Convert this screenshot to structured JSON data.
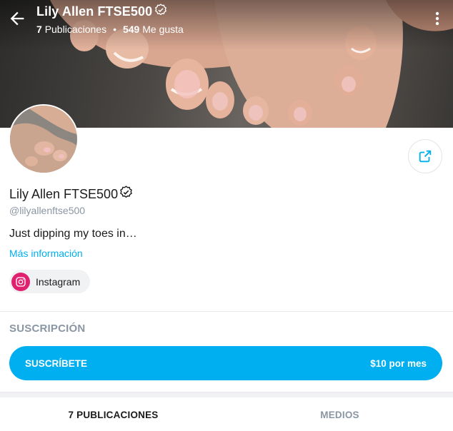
{
  "header": {
    "title": "Lily Allen FTSE500",
    "posts_count": "7",
    "posts_label": "Publicaciones",
    "separator": "•",
    "likes_count": "549",
    "likes_label": "Me gusta"
  },
  "profile": {
    "name": "Lily Allen FTSE500",
    "handle": "@lilyallenftse500",
    "bio": "Just dipping my toes in…",
    "more_info": "Más información",
    "social": [
      {
        "label": "Instagram",
        "icon": "instagram-icon",
        "color": "#e0216f"
      }
    ]
  },
  "subscription": {
    "section_title": "SUSCRIPCIÓN",
    "button_label": "SUSCRÍBETE",
    "price": "$10 por mes",
    "accent": "#00aff0"
  },
  "tabs": [
    {
      "label": "7 PUBLICACIONES",
      "active": true
    },
    {
      "label": "MEDIOS",
      "active": false
    }
  ],
  "icons": [
    "back-arrow-icon",
    "verified-icon",
    "more-vertical-icon",
    "share-icon",
    "instagram-icon"
  ]
}
